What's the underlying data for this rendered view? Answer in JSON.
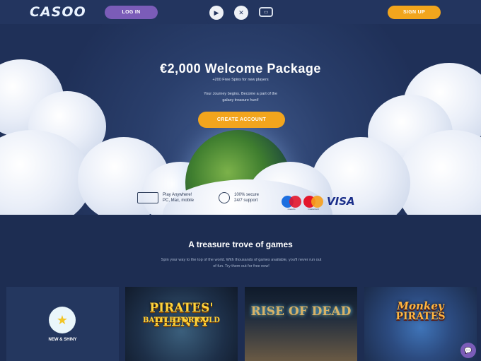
{
  "header": {
    "logo": "CASOO",
    "login_label": "LOG IN",
    "signup_label": "SIGN UP",
    "tabs": [
      "play-icon",
      "chip-icon",
      "live-tv-icon"
    ]
  },
  "hero": {
    "title": "€2,000 Welcome Package",
    "subtitle": "+200 Free Spins for new players",
    "text": "Your Journey begins. Become a part of the galaxy treasure hunt!",
    "cta_label": "CREATE ACCOUNT",
    "features": [
      {
        "icon": "devices-icon",
        "line1": "Play Anywhere!",
        "line2": "PC, Mac, mobile"
      },
      {
        "icon": "support-icon",
        "line1": "100% secure",
        "line2": "24/7 support"
      }
    ],
    "payments": {
      "maestro": "maestro",
      "mastercard": "mastercard",
      "visa": "VISA"
    }
  },
  "games": {
    "title": "A treasure trove of games",
    "text": "Spin your way to the top of the world. With thousands of games available, you'll never run out of fun. Try them out for free now!",
    "new_label": "NEW & SHINY",
    "cards": [
      {
        "line1": "PIRATES' PLENTY",
        "line2": "BATTLE FOR GOLD"
      },
      {
        "line1": "RISE OF DEAD"
      },
      {
        "line1": "Monkey",
        "line2": "PIRATES"
      }
    ]
  },
  "colors": {
    "accent": "#f2a51d",
    "login": "#7b5cb8",
    "background": "#1d2d52"
  }
}
